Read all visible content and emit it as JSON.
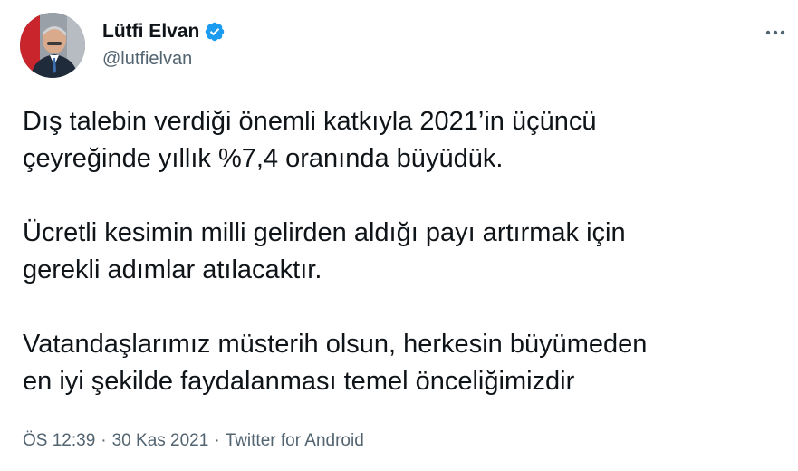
{
  "tweet": {
    "author": {
      "display_name": "Lütfi Elvan",
      "handle": "@lutfielvan",
      "verified": true
    },
    "paragraphs": [
      "Dış talebin verdiği önemli katkıyla 2021’in üçüncü\nçeyreğinde yıllık %7,4 oranında büyüdük.",
      "Ücretli kesimin milli gelirden aldığı payı artırmak için\ngerekli adımlar atılacaktır.",
      "Vatandaşlarımız müsterih olsun, herkesin büyümeden\nen iyi şekilde faydalanması temel önceliğimizdir"
    ],
    "meta": {
      "time": "ÖS 12:39",
      "separator": "·",
      "date": "30 Kas 2021",
      "source": "Twitter for Android"
    }
  },
  "icons": {
    "verified": "verified-badge-icon",
    "more": "more-options-icon"
  },
  "colors": {
    "text_primary": "#0f1419",
    "text_secondary": "#536471",
    "verified_blue": "#1d9bf0"
  }
}
